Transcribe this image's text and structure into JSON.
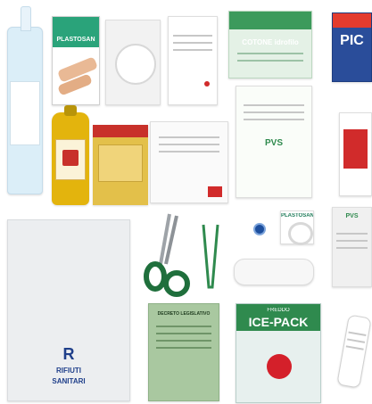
{
  "products": {
    "plastosan_top": {
      "brand": "PLASTOSAN"
    },
    "cotone": {
      "title": "COTONE idrofilo",
      "pvs": "PVS"
    },
    "pic": {
      "brand": "PIC"
    },
    "gauze_pvs": {
      "brand": "PVS"
    },
    "plastosan_tape": {
      "brand": "PLASTOSAN"
    },
    "rifiuti": {
      "letter": "R",
      "line1": "RIFIUTI",
      "line2": "SANITARI"
    },
    "decreto": {
      "title": "DECRETO LEGISLATIVO"
    },
    "icepack": {
      "small": "FREDDO",
      "title": "ICE-PACK"
    }
  },
  "colors": {
    "pvs_green": "#2f8a4e",
    "plastosan_red": "#c0272d",
    "scissors_green": "#1f6f3c",
    "bottle_yellow": "#e3b40d",
    "saline_blue": "#cfe6f2",
    "bag": "#eceef0",
    "decreto": "#a9c8a0",
    "ice_red": "#d4202a"
  }
}
